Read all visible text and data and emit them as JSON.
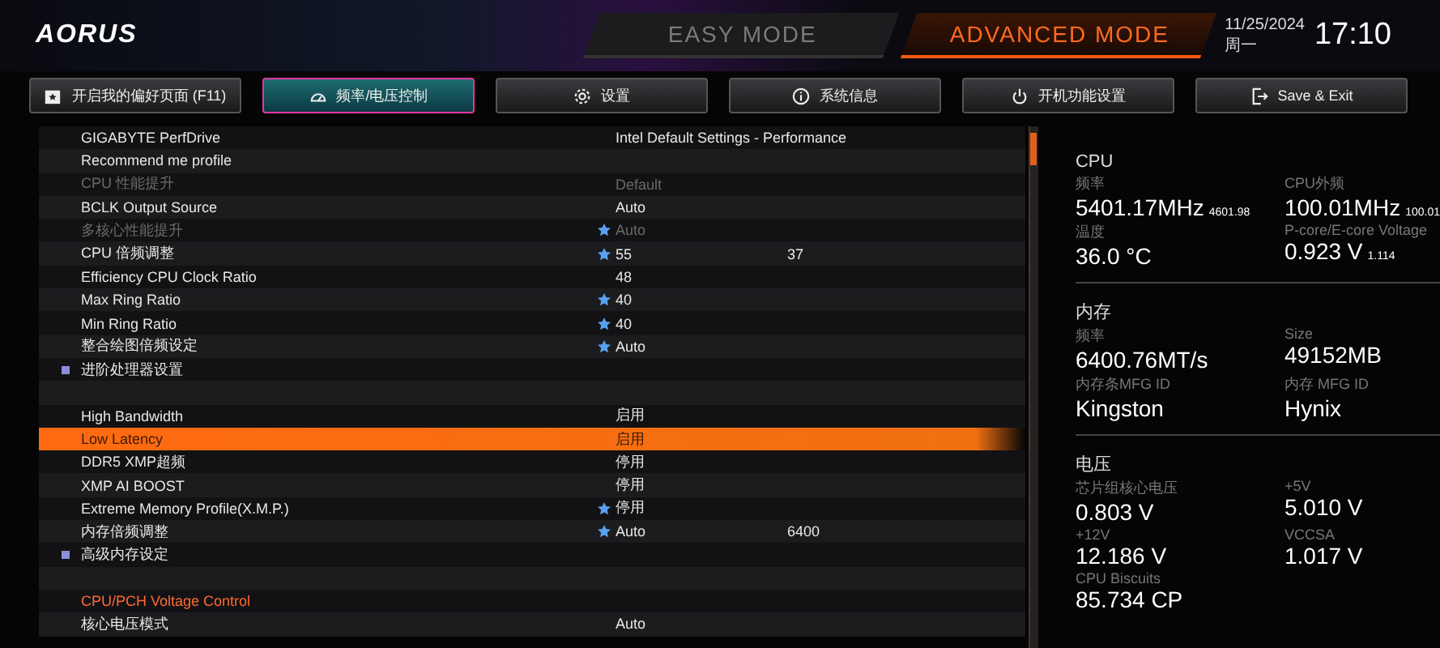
{
  "header": {
    "logo": "AORUS",
    "modes": [
      {
        "label": "EASY MODE",
        "selected": false
      },
      {
        "label": "ADVANCED MODE",
        "selected": true
      }
    ],
    "date": "11/25/2024",
    "weekday": "周一",
    "time": "17:10"
  },
  "tabs": [
    {
      "label": "开启我的偏好页面 (F11)",
      "selected": false
    },
    {
      "label": "频率/电压控制",
      "selected": true
    },
    {
      "label": "设置",
      "selected": false
    },
    {
      "label": "系统信息",
      "selected": false
    },
    {
      "label": "开机功能设置",
      "selected": false
    },
    {
      "label": "Save & Exit",
      "selected": false
    }
  ],
  "settings": [
    {
      "kind": "item",
      "label": "GIGABYTE PerfDrive",
      "value": "Intel Default Settings - Performance",
      "favorite": false,
      "disabled": false,
      "selected": false
    },
    {
      "kind": "item",
      "label": "Recommend me profile",
      "favorite": false,
      "disabled": false,
      "selected": false
    },
    {
      "kind": "item",
      "label": "CPU 性能提升",
      "value": "Default",
      "favorite": false,
      "disabled": true,
      "selected": false
    },
    {
      "kind": "item",
      "label": "BCLK Output Source",
      "value": "Auto",
      "favorite": false,
      "disabled": false,
      "selected": false
    },
    {
      "kind": "item",
      "label": "多核心性能提升",
      "value": "Auto",
      "favorite": true,
      "disabled": true,
      "selected": false
    },
    {
      "kind": "item",
      "label": "CPU 倍频调整",
      "value": "55",
      "current": "37",
      "favorite": true,
      "disabled": false,
      "selected": false
    },
    {
      "kind": "item",
      "label": "Efficiency CPU Clock Ratio",
      "value": "48",
      "favorite": false,
      "disabled": false,
      "selected": false
    },
    {
      "kind": "item",
      "label": "Max Ring Ratio",
      "value": "40",
      "favorite": true,
      "disabled": false,
      "selected": false
    },
    {
      "kind": "item",
      "label": "Min Ring Ratio",
      "value": "40",
      "favorite": true,
      "disabled": false,
      "selected": false
    },
    {
      "kind": "item",
      "label": "整合绘图倍频设定",
      "value": "Auto",
      "favorite": true,
      "disabled": false,
      "selected": false
    },
    {
      "kind": "submenu",
      "label": "进阶处理器设置"
    },
    {
      "kind": "blank"
    },
    {
      "kind": "item",
      "label": "High Bandwidth",
      "value": "启用",
      "favorite": false,
      "disabled": false,
      "selected": false
    },
    {
      "kind": "item",
      "label": "Low Latency",
      "value": "启用",
      "favorite": false,
      "disabled": false,
      "selected": true
    },
    {
      "kind": "item",
      "label": "DDR5 XMP超频",
      "value": "停用",
      "favorite": false,
      "disabled": false,
      "selected": false
    },
    {
      "kind": "item",
      "label": "XMP AI BOOST",
      "value": "停用",
      "favorite": false,
      "disabled": false,
      "selected": false
    },
    {
      "kind": "item",
      "label": "Extreme Memory Profile(X.M.P.)",
      "value": "停用",
      "favorite": true,
      "disabled": false,
      "selected": false
    },
    {
      "kind": "item",
      "label": "内存倍频调整",
      "value": "Auto",
      "current": "6400",
      "favorite": true,
      "disabled": false,
      "selected": false
    },
    {
      "kind": "submenu",
      "label": "高级内存设定"
    },
    {
      "kind": "blank"
    },
    {
      "kind": "section",
      "label": "CPU/PCH Voltage Control"
    },
    {
      "kind": "item",
      "label": "核心电压模式",
      "value": "Auto",
      "favorite": false,
      "disabled": false,
      "selected": false
    }
  ],
  "monitor": [
    {
      "title": "CPU",
      "stats": [
        {
          "label": "频率",
          "value": "5401.17MHz",
          "sub": "4601.98"
        },
        {
          "label": "CPU外频",
          "value": "100.01MHz",
          "sub": "100.01"
        },
        {
          "label": "温度",
          "value": "36.0 °C"
        },
        {
          "label": "P-core/E-core Voltage",
          "value": "0.923 V",
          "sub": "1.114"
        }
      ]
    },
    {
      "title": "内存",
      "stats": [
        {
          "label": "频率",
          "value": "6400.76MT/s"
        },
        {
          "label": "Size",
          "value": "49152MB"
        },
        {
          "label": "内存条MFG ID",
          "value": "Kingston"
        },
        {
          "label": "内存 MFG ID",
          "value": "Hynix"
        }
      ]
    },
    {
      "title": "电压",
      "stats": [
        {
          "label": "芯片组核心电压",
          "value": "0.803 V"
        },
        {
          "label": "+5V",
          "value": "5.010 V"
        },
        {
          "label": "+12V",
          "value": "12.186 V"
        },
        {
          "label": "VCCSA",
          "value": "1.017 V"
        },
        {
          "label": "CPU Biscuits",
          "value": "85.734 CP"
        }
      ]
    }
  ]
}
